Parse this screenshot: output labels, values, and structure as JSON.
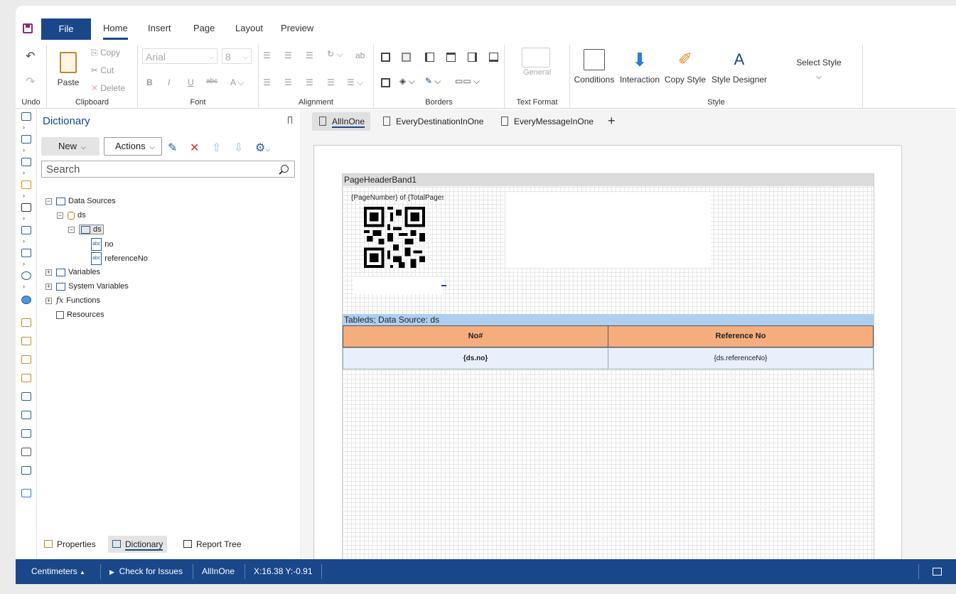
{
  "menu": {
    "file": "File",
    "tabs": [
      "Home",
      "Insert",
      "Page",
      "Layout",
      "Preview"
    ],
    "active_tab": "Home"
  },
  "ribbon": {
    "undo_group": "Undo",
    "clipboard_group": "Clipboard",
    "paste": "Paste",
    "copy": "Copy",
    "cut": "Cut",
    "delete": "Delete",
    "font_group": "Font",
    "font_name": "Arial",
    "font_size": "8",
    "alignment_group": "Alignment",
    "borders_group": "Borders",
    "text_format_group": "Text Format",
    "text_format_value": "General",
    "style_group": "Style",
    "conditions": "Conditions",
    "interaction": "Interaction",
    "copy_style": "Copy Style",
    "style_designer": "Style Designer",
    "select_style": "Select Style"
  },
  "dictionary": {
    "title": "Dictionary",
    "new_button": "New",
    "actions_button": "Actions",
    "search_placeholder": "Search",
    "tree": {
      "data_sources": "Data Sources",
      "ds_connection": "ds",
      "ds_table": "ds",
      "col_no": "no",
      "col_reference": "referenceNo",
      "variables": "Variables",
      "system_variables": "System Variables",
      "functions": "Functions",
      "resources": "Resources"
    },
    "bottom_tabs": [
      "Properties",
      "Dictionary",
      "Report Tree"
    ],
    "active_bottom_tab": "Dictionary"
  },
  "pages": {
    "tabs": [
      "AllInOne",
      "EveryDestinationInOne",
      "EveryMessageInOne"
    ],
    "active": "AllInOne"
  },
  "report": {
    "page_header_band": "PageHeaderBand1",
    "page_number_text": "{PageNumber} of {TotalPages}",
    "data_band": "Tableds; Data Source: ds",
    "headers": [
      "No#",
      "Reference No"
    ],
    "cells": [
      "{ds.no}",
      "{ds.referenceNo}"
    ],
    "header_color": "#f5ad7e",
    "data_band_color": "#aecff0"
  },
  "status": {
    "units": "Centimeters",
    "check_issues": "Check for Issues",
    "current_page": "AllInOne",
    "coords": "X:16.38 Y:-0.91"
  },
  "colors": {
    "brand": "#19478a"
  }
}
